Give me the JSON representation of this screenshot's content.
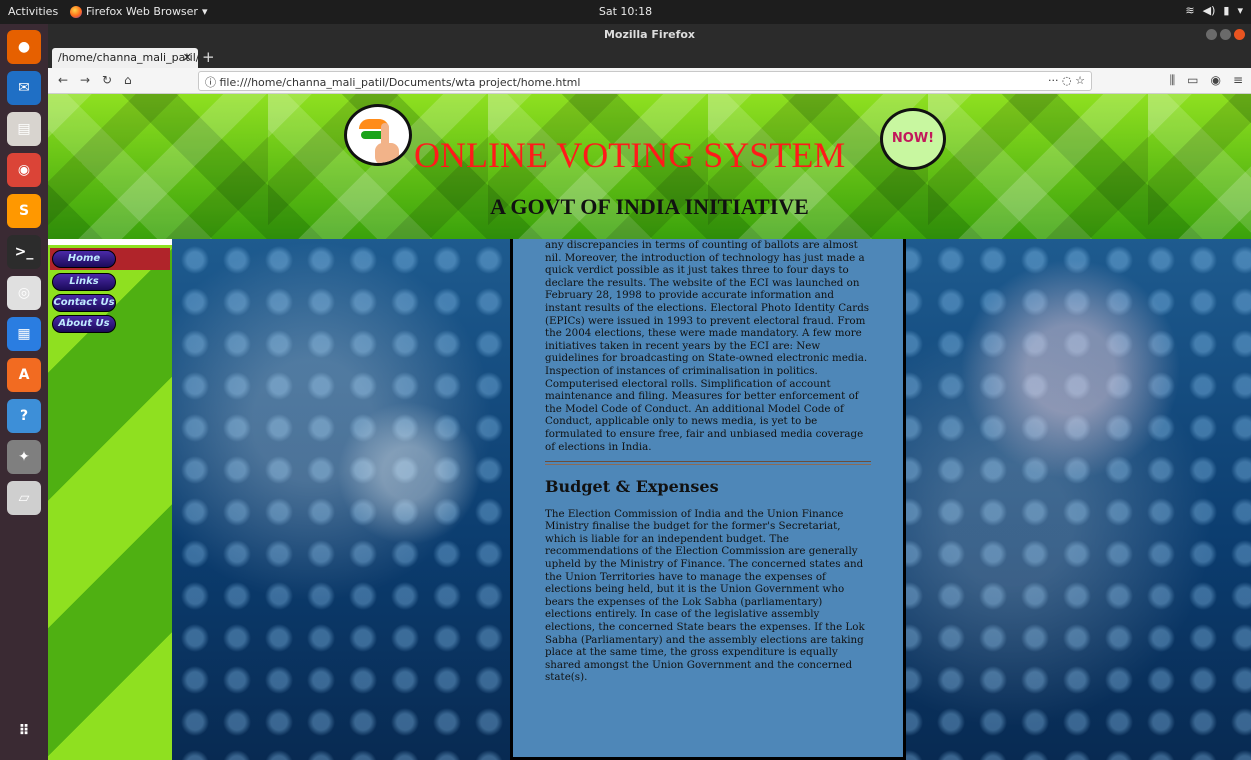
{
  "topbar": {
    "activities": "Activities",
    "app_menu": "Firefox Web Browser",
    "clock": "Sat 10:18"
  },
  "dock": {
    "items": [
      {
        "name": "firefox",
        "color": "#e66000"
      },
      {
        "name": "thunderbird",
        "color": "#1f6fc5"
      },
      {
        "name": "files",
        "color": "#d8d4cf"
      },
      {
        "name": "chrome",
        "color": "#db4437"
      },
      {
        "name": "sublime-text",
        "color": "#ff9800"
      },
      {
        "name": "terminal",
        "color": "#2c2c2c"
      },
      {
        "name": "webcam",
        "color": "#e0e0e0"
      },
      {
        "name": "writer",
        "color": "#2a7de1"
      },
      {
        "name": "software",
        "color": "#f26b21"
      },
      {
        "name": "help",
        "color": "#3d8fd8"
      },
      {
        "name": "settings",
        "color": "#7f7f7f"
      },
      {
        "name": "scanner",
        "color": "#cfcfcf"
      }
    ]
  },
  "browser": {
    "window_title": "Mozilla Firefox",
    "tab_title": "/home/channa_mali_patil/D",
    "url": "file:///home/channa_mali_patil/Documents/wta project/home.html"
  },
  "site": {
    "title": "ONLINE VOTING SYSTEM",
    "subtitle": "A GOVT OF INDIA INITIATIVE",
    "badge": "NOW!",
    "nav": [
      {
        "label": "Home",
        "active": true
      },
      {
        "label": "Links",
        "active": false
      },
      {
        "label": "Contact Us",
        "active": false
      },
      {
        "label": "About Us",
        "active": false
      }
    ],
    "paragraph1": "any discrepancies in terms of counting of ballots are almost nil. Moreover, the introduction of technology has just made a quick verdict possible as it just takes three to four days to declare the results. The website of the ECI was launched on February 28, 1998 to provide accurate information and instant results of the elections. Electoral Photo Identity Cards (EPICs) were issued in 1993 to prevent electoral fraud. From the 2004 elections, these were made mandatory. A few more initiatives taken in recent years by the ECI are: New guidelines for broadcasting on State-owned electronic media. Inspection of instances of criminalisation in politics. Computerised electoral rolls. Simplification of account maintenance and filing. Measures for better enforcement of the Model Code of Conduct. An additional Model Code of Conduct, applicable only to news media, is yet to be formulated to ensure free, fair and unbiased media coverage of elections in India.",
    "section_heading": "Budget & Expenses",
    "paragraph2": "The Election Commission of India and the Union Finance Ministry finalise the budget for the former's Secretariat, which is liable for an independent budget. The recommendations of the Election Commission are generally upheld by the Ministry of Finance. The concerned states and the Union Territories have to manage the expenses of elections being held, but it is the Union Government who bears the expenses of the Lok Sabha (parliamentary) elections entirely. In case of the legislative assembly elections, the concerned State bears the expenses. If the Lok Sabha (Parliamentary) and the assembly elections are taking place at the same time, the gross expenditure is equally shared amongst the Union Government and the concerned state(s)."
  }
}
